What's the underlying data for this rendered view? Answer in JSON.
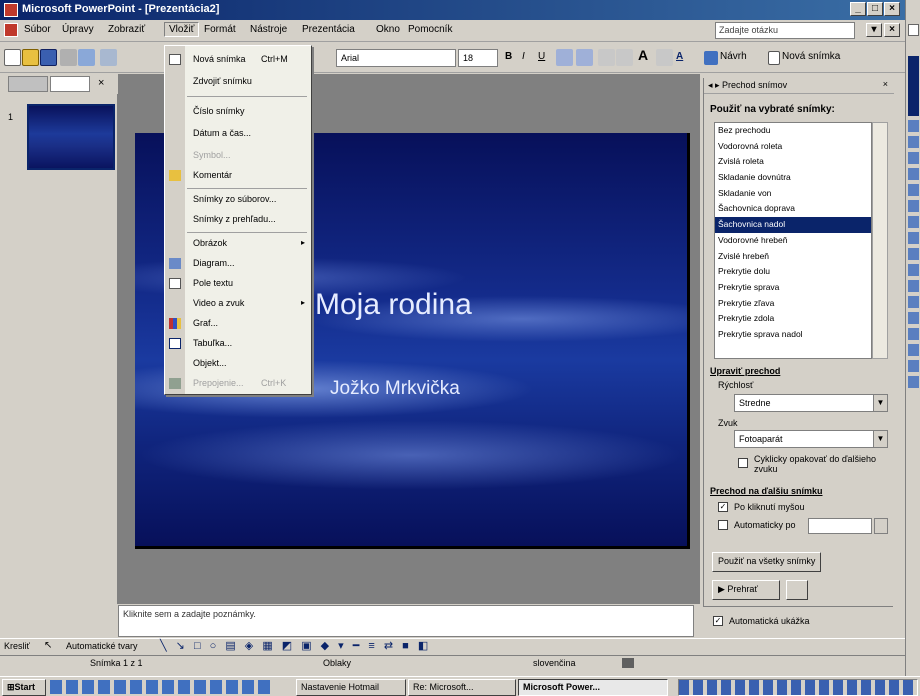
{
  "window": {
    "title": "Microsoft PowerPoint - [Prezentácia2]"
  },
  "menubar": {
    "items": [
      "Súbor",
      "Úpravy",
      "Zobraziť",
      "Vložiť",
      "Formát",
      "Nástroje",
      "Prezentácia",
      "Okno",
      "Pomocník"
    ],
    "ask_placeholder": "Zadajte otázku"
  },
  "toolbar": {
    "font_name": "Arial",
    "font_size": "18",
    "design_label": "Návrh",
    "new_slide_label": "Nová snímka"
  },
  "insert_menu": {
    "items": [
      {
        "label": "Nová snímka",
        "shortcut": "Ctrl+M",
        "disabled": false,
        "icon": "new-slide-icon"
      },
      {
        "label": "Zdvojiť snímku",
        "disabled": false
      },
      {
        "label": "Číslo snímky",
        "disabled": false
      },
      {
        "label": "Dátum a čas...",
        "disabled": false
      },
      {
        "label": "Symbol...",
        "disabled": true
      },
      {
        "label": "Komentár",
        "disabled": false,
        "icon": "comment-icon"
      },
      {
        "label": "Snímky zo súborov...",
        "disabled": false
      },
      {
        "label": "Snímky z prehľadu...",
        "disabled": false
      },
      {
        "label": "Obrázok",
        "disabled": false,
        "submenu": true
      },
      {
        "label": "Diagram...",
        "disabled": false,
        "icon": "diagram-icon"
      },
      {
        "label": "Pole textu",
        "disabled": false,
        "icon": "textbox-icon"
      },
      {
        "label": "Video a zvuk",
        "disabled": false,
        "submenu": true
      },
      {
        "label": "Graf...",
        "disabled": false,
        "icon": "chart-icon"
      },
      {
        "label": "Tabuľka...",
        "disabled": false,
        "icon": "table-icon"
      },
      {
        "label": "Objekt...",
        "disabled": false
      },
      {
        "label": "Prepojenie...",
        "shortcut": "Ctrl+K",
        "disabled": true,
        "icon": "hyperlink-icon"
      }
    ]
  },
  "slide": {
    "title": "Moja rodina",
    "subtitle": "Jožko Mrkvička",
    "number": "1"
  },
  "taskpane": {
    "header": "Prechod snímov",
    "apply_heading": "Použiť na vybraté snímky:",
    "transitions": [
      "Bez prechodu",
      "Vodorovná roleta",
      "Zvislá roleta",
      "Skladanie dovnútra",
      "Skladanie von",
      "Šachovnica doprava",
      "Šachovnica nadol",
      "Vodorovné hrebeň",
      "Zvislé hrebeň",
      "Prekrytie dolu",
      "Prekrytie sprava",
      "Prekrytie zľava",
      "Prekrytie zdola",
      "Prekrytie sprava nadol"
    ],
    "selected_index": 6,
    "modify_heading": "Upraviť prechod",
    "speed_label": "Rýchlosť",
    "speed_value": "Stredne",
    "sound_label": "Zvuk",
    "sound_value": "Fotoaparát",
    "loop_label": "Cyklicky opakovať do ďalšieho zvuku",
    "advance_heading": "Prechod na ďalšiu snímku",
    "on_click_label": "Po kliknutí myšou",
    "on_click_checked": true,
    "auto_label": "Automaticky po",
    "auto_checked": false,
    "apply_all_button": "Použiť na všetky snímky",
    "play_button": "Prehrať",
    "autopreview_label": "Automatická ukážka",
    "autopreview_checked": true
  },
  "notes": {
    "placeholder": "Kliknite sem a zadajte poznámky."
  },
  "drawbar": {
    "draw_label": "Kresliť",
    "autoshapes_label": "Automatické tvary"
  },
  "statusbar": {
    "slide_info": "Snímka 1 z 1",
    "design": "Oblaky",
    "language": "slovenčina"
  },
  "taskbar": {
    "start": "Start",
    "tasks": [
      "Nastavenie Hotmail",
      "Re: Microsoft...",
      "Microsoft Power..."
    ]
  }
}
